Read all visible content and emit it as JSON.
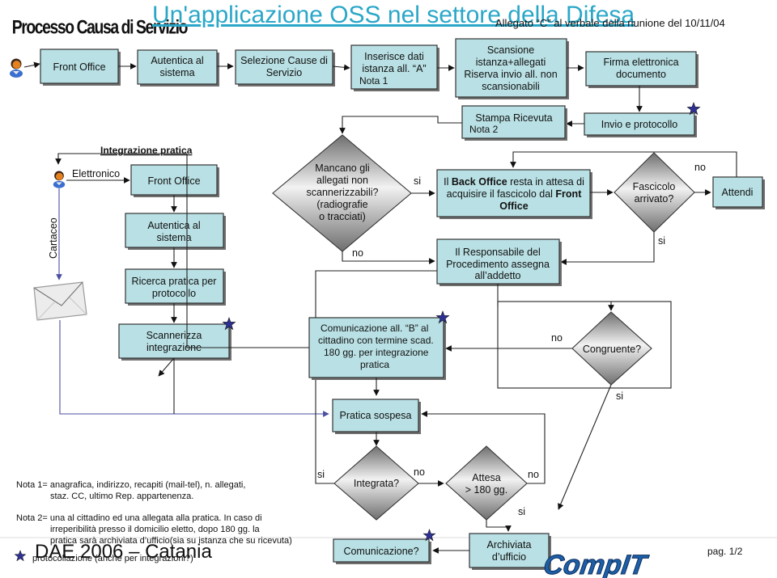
{
  "header": {
    "left_title": "Processo Causa di Servizio",
    "main_title": "Un'applicazione OSS nel settore della Difesa",
    "subtitle": "Allegato “C”  al verbale della riunione del 10/11/04"
  },
  "top_flow": {
    "front_office": "Front Office",
    "autentica": [
      "Autentica al",
      "sistema"
    ],
    "selezione": [
      "Selezione Cause di",
      "Servizio"
    ],
    "inserisce": [
      "Inserisce dati",
      "istanza all. “A”",
      "Nota 1"
    ],
    "scansione": [
      "Scansione",
      "istanza+allegati",
      "Riserva invio all. non",
      "scansionabili"
    ],
    "firma": [
      "Firma elettronica",
      "documento"
    ],
    "invio": "Invio e protocollo",
    "stampa": [
      "Stampa Ricevuta",
      "Nota 2"
    ]
  },
  "integration": {
    "heading": "Integrazione pratica",
    "elettronico": "Elettronico",
    "cartaceo": "Cartaceo",
    "front_office": "Front Office",
    "autentica": [
      "Autentica al",
      "sistema"
    ],
    "ricerca": [
      "Ricerca pratica per",
      "protocollo"
    ],
    "scannerizza": [
      "Scannerizza",
      "integrazione"
    ]
  },
  "decisions": {
    "mancano": [
      "Mancano gli",
      "allegati non",
      "scannerizzabili?",
      "(radiografie",
      "o tracciati)"
    ],
    "fascicolo": [
      "Fascicolo",
      "arrivato?"
    ],
    "congruente": "Congruente?",
    "integrata": "Integrata?",
    "attesa": [
      "Attesa",
      "> 180 gg."
    ]
  },
  "process": {
    "back_office_parts": [
      "Il ",
      "Back Office",
      " resta in attesa di",
      "acquisire il fascicolo dal ",
      "Front",
      "Office"
    ],
    "responsabile": [
      "Il Responsabile del",
      "Procedimento assegna",
      "all’addetto"
    ],
    "attendi": "Attendi",
    "comunicazione_b": [
      "Comunicazione all. “B” al",
      "cittadino con termine scad.",
      "180 gg. per integrazione",
      "pratica"
    ],
    "pratica_sospesa": "Pratica sospesa",
    "comunicazione": "Comunicazione?",
    "archiviata": [
      "Archiviata",
      "d’ufficio"
    ]
  },
  "edge_labels": {
    "si": "si",
    "no": "no"
  },
  "notes": {
    "nota1": [
      "Nota 1= anagrafica, indirizzo, recapiti (mail-tel), n. allegati,",
      "staz. CC, ultimo Rep. appartenenza."
    ],
    "nota2": [
      "Nota 2= una al cittadino ed una  allegata  alla  pratica.  In caso di",
      "irreperibilità  presso  il  domicilio eletto,  dopo 180 gg. la",
      "pratica sarà archiviata d’ufficio(sia su istanza che su ricevuta)"
    ],
    "star_legend": "protocollazione (anche per integrazioni?)"
  },
  "footer": {
    "event": "DAE 2006 – Catania",
    "logo": "CompIT",
    "page": "pag. 1/2"
  },
  "colors": {
    "box_fill": "#b9e0e4",
    "title_blue": "#2aa7c8",
    "star": "#2e3192",
    "cartaceo_line": "#4a4fa0"
  }
}
